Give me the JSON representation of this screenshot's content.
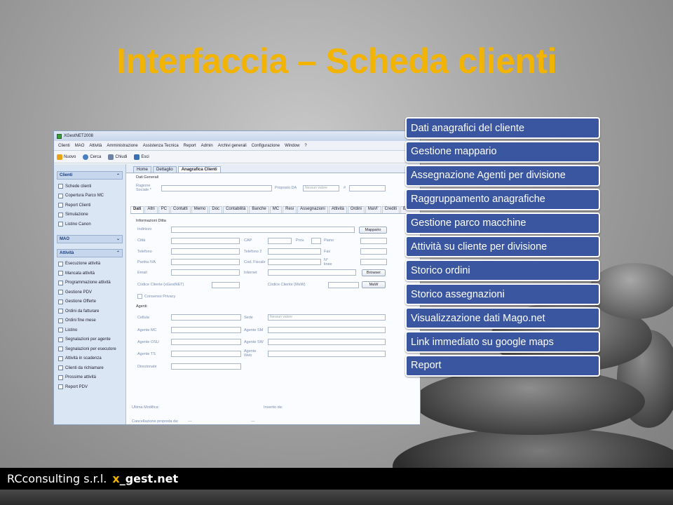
{
  "slide": {
    "title": "Interfaccia – Scheda clienti"
  },
  "app": {
    "window_title": "XGestNET2008",
    "menu": [
      "Clienti",
      "MAO",
      "Attività",
      "Amministrazione",
      "Assistenza Tecnica",
      "Report",
      "Admin",
      "Archivi generali",
      "Configurazione",
      "Window",
      "?"
    ],
    "toolbar": [
      {
        "label": "Nuovo",
        "color": "#e8a317"
      },
      {
        "label": "Cerca",
        "color": "#4a7fc1"
      },
      {
        "label": "Chiudi",
        "color": "#6c82a4"
      },
      {
        "label": "Esci",
        "color": "#3b6fb6"
      }
    ],
    "sidebar": {
      "sections": [
        {
          "title": "Clienti",
          "items": [
            "Schede clienti",
            "Copertura Parco MC",
            "Report Clienti",
            "Simulazione",
            "Listino Canon"
          ]
        },
        {
          "title": "MAO",
          "items": []
        },
        {
          "title": "Attività",
          "items": [
            "Esecuzione attività",
            "Mancata attività",
            "Programmazione attività",
            "Gestione PDV",
            "Gestione Offerte",
            "Ordini da fatturare",
            "Ordini fine mese",
            "Listino",
            "Segnalazioni per agente",
            "Segnalazioni per esecutore",
            "Attività in scadenza",
            "Clienti da richiamare",
            "Prossime attività",
            "Report PDV"
          ]
        }
      ]
    },
    "top_tabs": [
      "Home",
      "Dettaglio",
      "Anagrafica Clienti"
    ],
    "form": {
      "section_general": "Dati Generali",
      "ragione_sociale": "Ragione Sociale *",
      "proposto_da": "Proposto DA",
      "nessun_valore": "Nessun valore",
      "hash": "#",
      "subtabs": [
        "Dati",
        "Altri",
        "PC",
        "Contatti",
        "Memo",
        "Doc",
        "Contabilità",
        "Banche",
        "MC",
        "Resi",
        "Assegnazioni",
        "Attività",
        "Ordini",
        "MaVi'",
        "Crediti",
        "Browser"
      ],
      "info_title": "Informazioni Ditta",
      "labels_left": [
        "Indirizzo",
        "Città",
        "Telefono",
        "Partita IVA",
        "Email",
        "Codice Cliente (xGestNET)"
      ],
      "labels_mid": [
        "CAP",
        "Telefono 2",
        "Cod. Fiscale",
        "Internet",
        "Codice Cliente (MxW)"
      ],
      "labels_right": [
        "Prov.",
        "Piano",
        "Fax",
        "N° linee"
      ],
      "btn_mappario": "Mappario",
      "btn_browser": "Browser",
      "btn_maw": "MaW",
      "consenso": "Consenso Privacy",
      "agenti_title": "Agenti",
      "agenti_left": [
        "Cellula",
        "Agente MC",
        "Agente OSU",
        "Agente TS",
        "Direzionale"
      ],
      "agenti_right": [
        "Sede",
        "Agente SM",
        "Agente SW",
        "Agente Web"
      ],
      "sede_value": "Nessun valore",
      "ultima_modifica": "Ultima Modifica:",
      "inserito_da": "Inserito da:",
      "cancellazione": "Cancellazione proposta da:",
      "dashes": "---"
    }
  },
  "feature_list": [
    "Dati anagrafici del cliente",
    "Gestione mappario",
    "Assegnazione Agenti per divisione",
    "Raggruppamento anagrafiche",
    "Gestione parco macchine",
    "Attività su cliente per divisione",
    "Storico ordini",
    "Storico assegnazioni",
    "Visualizzazione dati Mago.net",
    "Link immediato su google maps",
    "Report"
  ],
  "footer": {
    "company": "RCconsulting s.r.l.",
    "brand_x": "x",
    "brand_rest": "_gest.net"
  },
  "colors": {
    "title": "#f3b400",
    "list_item_bg": "#3a56a0",
    "footer_bg": "#000000"
  }
}
